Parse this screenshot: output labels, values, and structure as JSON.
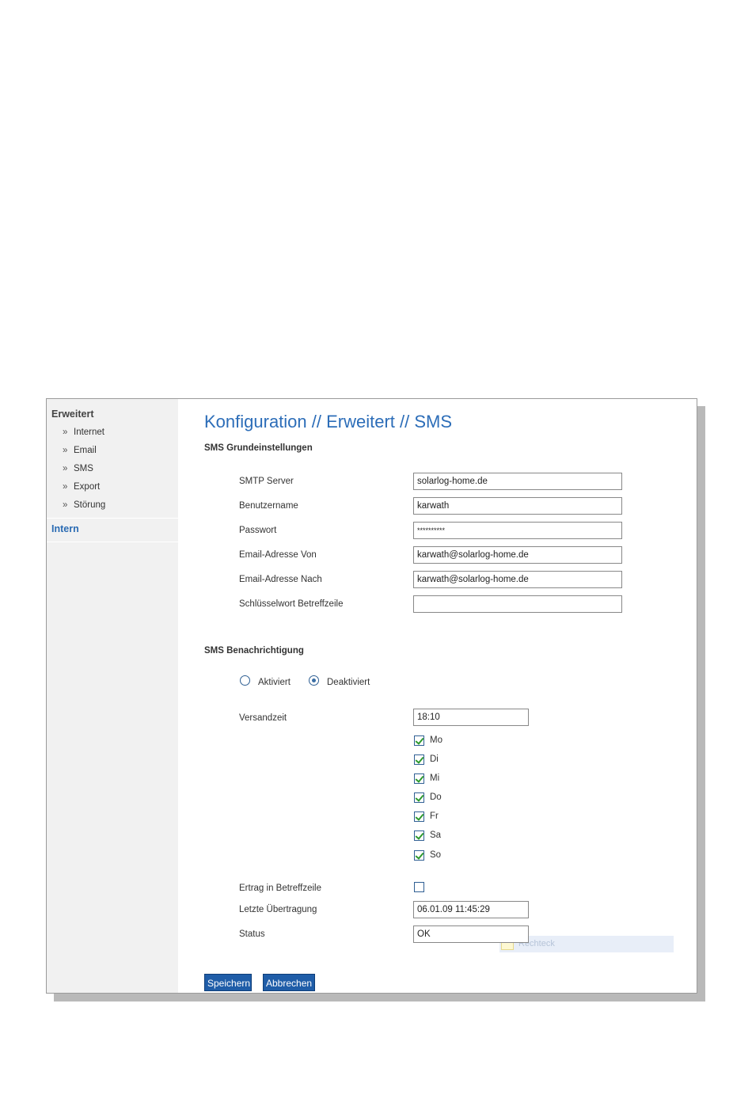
{
  "sidebar": {
    "heading": "Erweitert",
    "bullet": "»",
    "items": [
      {
        "label": "Internet"
      },
      {
        "label": "Email"
      },
      {
        "label": "SMS"
      },
      {
        "label": "Export"
      },
      {
        "label": "Störung"
      }
    ],
    "intern": "Intern"
  },
  "page": {
    "title": "Konfiguration // Erweitert // SMS"
  },
  "basic": {
    "heading": "SMS Grundeinstellungen",
    "fields": [
      {
        "label": "SMTP Server",
        "value": "solarlog-home.de"
      },
      {
        "label": "Benutzername",
        "value": "karwath"
      },
      {
        "label": "Passwort",
        "value": "**********"
      },
      {
        "label": "Email-Adresse Von",
        "value": "karwath@solarlog-home.de"
      },
      {
        "label": "Email-Adresse Nach",
        "value": "karwath@solarlog-home.de"
      },
      {
        "label": "Schlüsselwort Betreffzeile",
        "value": ""
      }
    ]
  },
  "notify": {
    "heading": "SMS Benachrichtigung",
    "radio_on": "Aktiviert",
    "radio_off": "Deaktiviert",
    "selected": "Deaktiviert",
    "time_label": "Versandzeit",
    "time_value": "18:10",
    "days": [
      {
        "label": "Mo",
        "checked": true
      },
      {
        "label": "Di",
        "checked": true
      },
      {
        "label": "Mi",
        "checked": true
      },
      {
        "label": "Do",
        "checked": true
      },
      {
        "label": "Fr",
        "checked": true
      },
      {
        "label": "Sa",
        "checked": true
      },
      {
        "label": "So",
        "checked": true
      }
    ],
    "yield_label": "Ertrag in Betreffzeile",
    "yield_checked": false,
    "last_label": "Letzte Übertragung",
    "last_value": "06.01.09  11:45:29",
    "status_label": "Status",
    "status_value": "OK"
  },
  "tooltip": {
    "text": "Rechteck"
  },
  "buttons": {
    "save": "Speichern",
    "cancel": "Abbrechen"
  }
}
